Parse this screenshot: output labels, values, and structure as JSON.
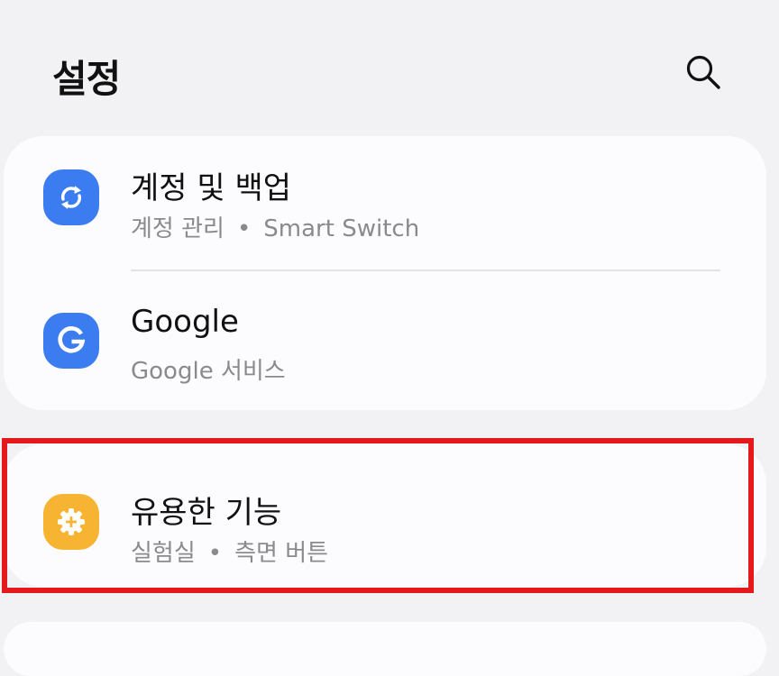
{
  "header": {
    "title": "설정",
    "search_icon": "search-icon"
  },
  "cards": [
    {
      "items": [
        {
          "id": "accounts-backup",
          "title": "계정 및 백업",
          "subtitle": [
            "계정 관리",
            "Smart Switch"
          ],
          "icon": "sync-icon",
          "icon_color": "#3b7cf0"
        },
        {
          "id": "google",
          "title": "Google",
          "subtitle": [
            "Google 서비스"
          ],
          "icon": "google-icon",
          "icon_color": "#3b7cf0"
        }
      ]
    },
    {
      "items": [
        {
          "id": "advanced-features",
          "title": "유용한 기능",
          "subtitle": [
            "실험실",
            "측면 버튼"
          ],
          "icon": "gear-plus-icon",
          "icon_color": "#f7b432"
        }
      ]
    }
  ],
  "highlight_color": "#e3191c"
}
